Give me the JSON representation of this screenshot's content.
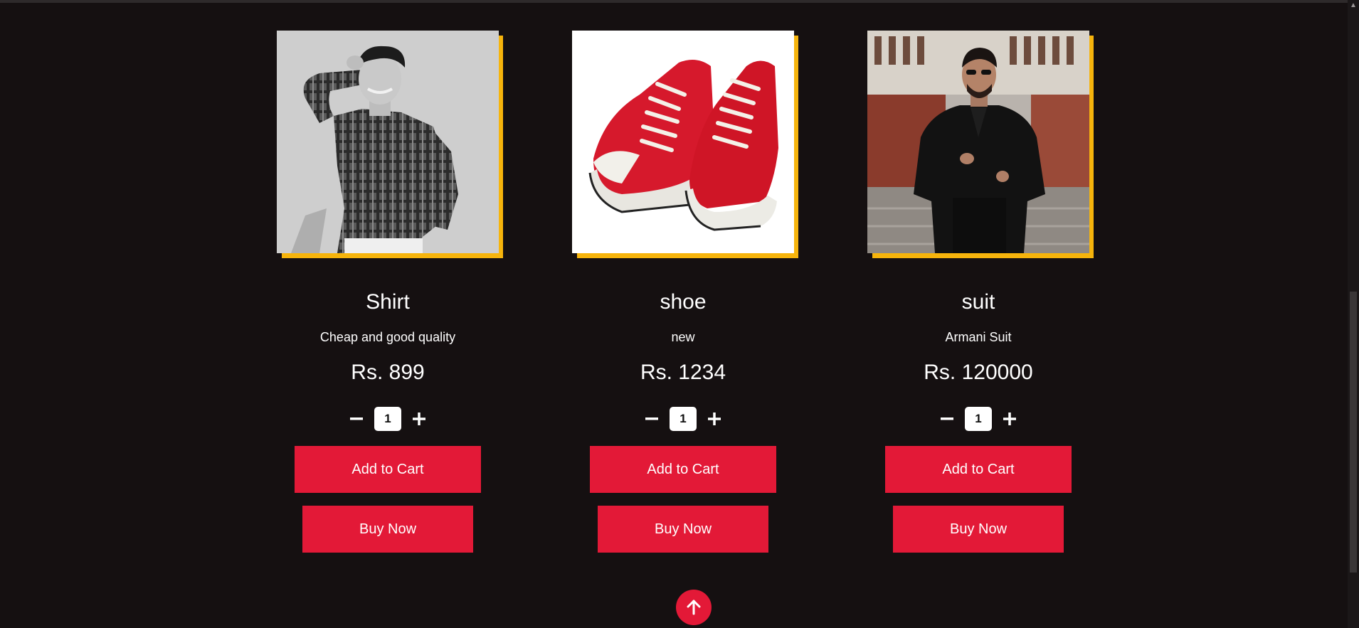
{
  "products": [
    {
      "name": "Shirt",
      "description": "Cheap and good quality",
      "price": "Rs. 899",
      "quantity": "1",
      "add_to_cart_label": "Add to Cart",
      "buy_now_label": "Buy Now"
    },
    {
      "name": "shoe",
      "description": "new",
      "price": "Rs. 1234",
      "quantity": "1",
      "add_to_cart_label": "Add to Cart",
      "buy_now_label": "Buy Now"
    },
    {
      "name": "suit",
      "description": "Armani Suit",
      "price": "Rs. 120000",
      "quantity": "1",
      "add_to_cart_label": "Add to Cart",
      "buy_now_label": "Buy Now"
    }
  ],
  "icons": {
    "decrease": "minus-icon",
    "increase": "plus-icon",
    "back_to_top": "arrow-up-icon"
  },
  "colors": {
    "background": "#151011",
    "accent": "#e31937",
    "image_border": "#f6b40c"
  }
}
